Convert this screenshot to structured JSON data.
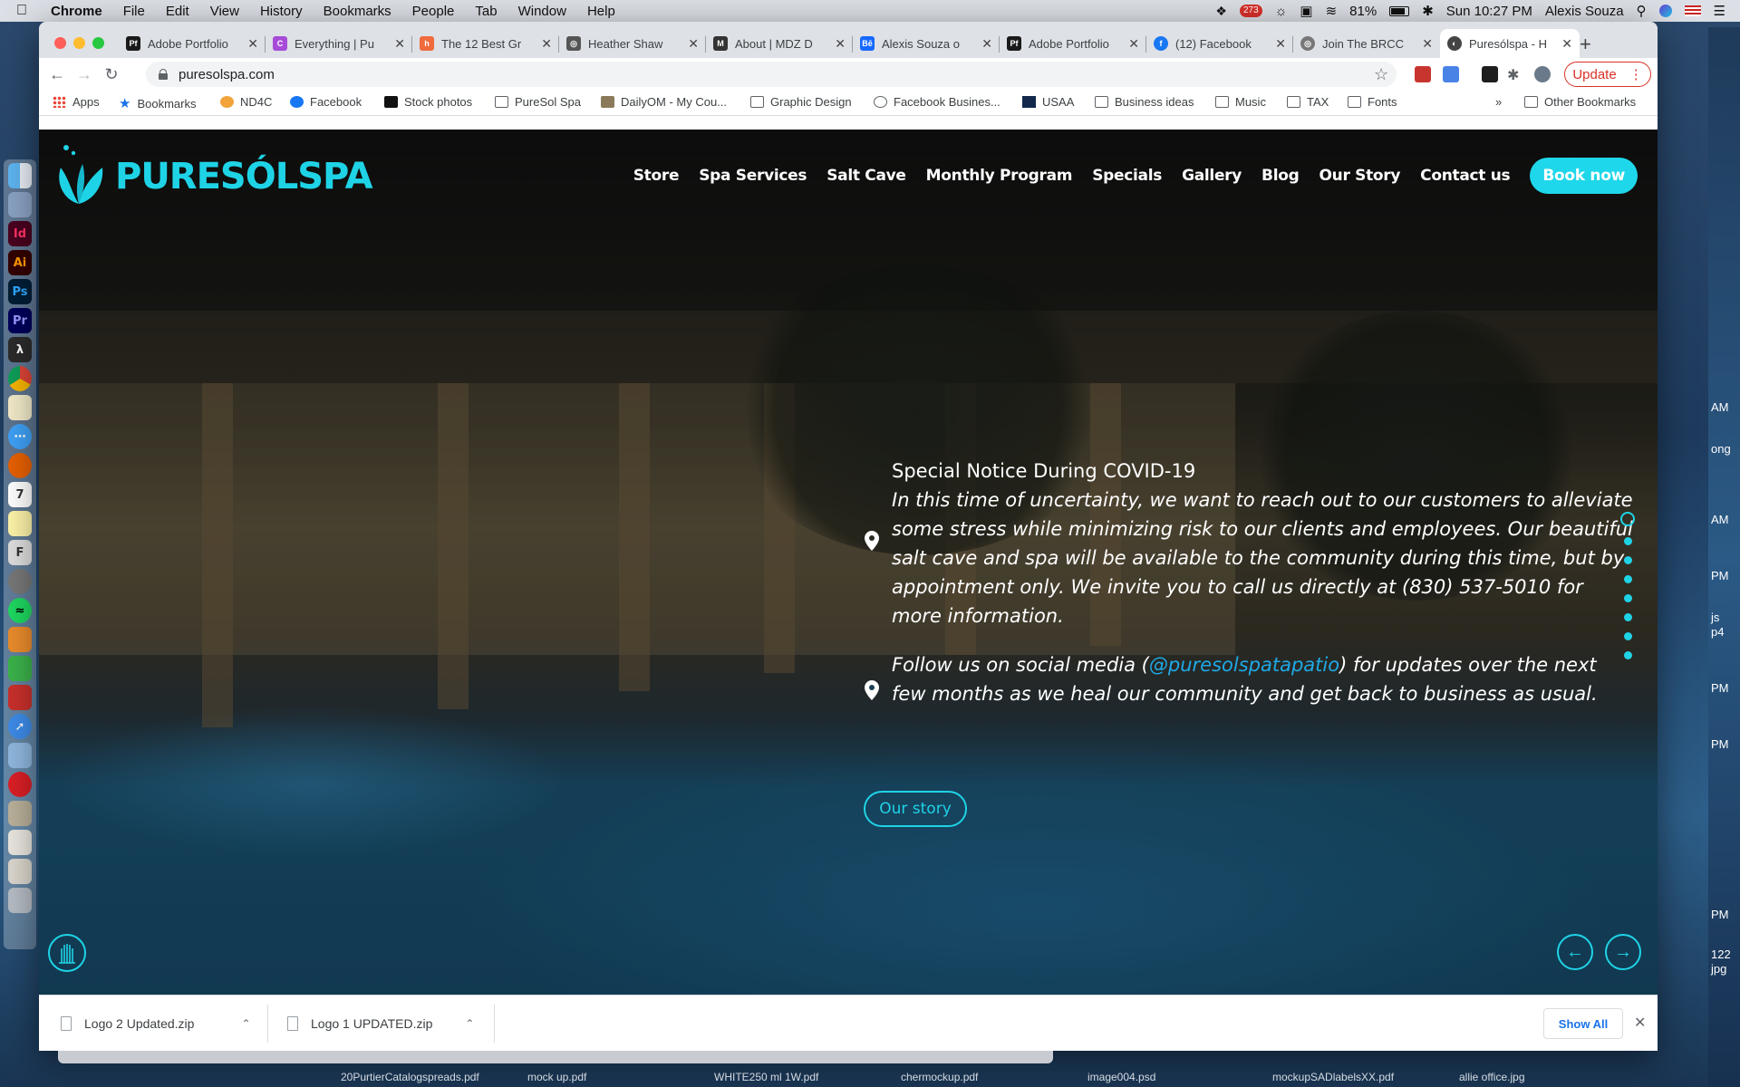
{
  "menubar": {
    "app": "Chrome",
    "items": [
      "File",
      "Edit",
      "View",
      "History",
      "Bookmarks",
      "People",
      "Tab",
      "Window",
      "Help"
    ],
    "mail_badge": "273",
    "battery": "81%",
    "datetime": "Sun 10:27 PM",
    "user": "Alexis Souza"
  },
  "tabs": [
    {
      "label": "Adobe Portfolio",
      "fav_color": "#1a1a1a",
      "fav_text": "Pf"
    },
    {
      "label": "Everything | Pu",
      "fav_color": "#a64bd8",
      "fav_text": "C"
    },
    {
      "label": "The 12 Best Gr",
      "fav_color": "#f06a3c",
      "fav_text": "h"
    },
    {
      "label": "Heather Shaw",
      "fav_color": "#555555",
      "fav_text": "◎"
    },
    {
      "label": "About | MDZ D",
      "fav_color": "#333333",
      "fav_text": "M"
    },
    {
      "label": "Alexis Souza o",
      "fav_color": "#1769ff",
      "fav_text": "Bē"
    },
    {
      "label": "Adobe Portfolio",
      "fav_color": "#1a1a1a",
      "fav_text": "Pf"
    },
    {
      "label": "(12) Facebook",
      "fav_color": "#1877f2",
      "fav_text": "f"
    },
    {
      "label": "Join The BRCC",
      "fav_color": "#777777",
      "fav_text": "◎"
    },
    {
      "label": "Puresólspa - H",
      "fav_color": "#444444",
      "fav_text": "◐"
    }
  ],
  "toolbar": {
    "url": "puresolspa.com",
    "update_label": "Update"
  },
  "bookmarks": [
    {
      "label": "Apps",
      "icon": "apps-grid-icon"
    },
    {
      "label": "Bookmarks",
      "icon": "star-icon"
    },
    {
      "label": "ND4C",
      "icon": "nd4c-icon"
    },
    {
      "label": "Facebook",
      "icon": "facebook-icon"
    },
    {
      "label": "Stock photos",
      "icon": "stock-icon"
    },
    {
      "label": "PureSol Spa",
      "icon": "folder-icon"
    },
    {
      "label": "DailyOM - My Cou...",
      "icon": "dailyom-icon"
    },
    {
      "label": "Graphic Design",
      "icon": "folder-icon"
    },
    {
      "label": "Facebook Busines...",
      "icon": "facebook-business-icon"
    },
    {
      "label": "USAA",
      "icon": "usaa-icon"
    },
    {
      "label": "Business ideas",
      "icon": "folder-icon"
    },
    {
      "label": "Music",
      "icon": "folder-icon"
    },
    {
      "label": "TAX",
      "icon": "folder-icon"
    },
    {
      "label": "Fonts",
      "icon": "folder-icon"
    }
  ],
  "bookmarks_overflow": "»",
  "other_bookmarks": "Other Bookmarks",
  "site": {
    "logo_text": "PURESÓLSPA",
    "nav": [
      "Store",
      "Spa Services",
      "Salt Cave",
      "Monthly Program",
      "Specials",
      "Gallery",
      "Blog",
      "Our Story",
      "Contact us"
    ],
    "book_now": "Book now",
    "notice_title": "Special Notice During COVID-19",
    "notice_body": "In this time of uncertainty, we want to reach out to our customers to alleviate some stress while minimizing risk to our clients and employees. Our beautiful salt cave and spa will be available to the community during this time, but by appointment only. We invite you to call us directly at (830) 537-5010 for more information.",
    "follow_pre": "Follow us on social media (",
    "follow_handle": "@puresolspatapatio",
    "follow_post": ") for updates over the next few months as we heal our community and get back to business as usual.",
    "our_story": "Our story",
    "slides_total": 8,
    "slide_active": 1,
    "accent": "#1fd3e6"
  },
  "downloads": [
    {
      "name": "Logo 2 Updated.zip"
    },
    {
      "name": "Logo 1 UPDATED.zip"
    }
  ],
  "downloads_show_all": "Show All",
  "desktop_labels": [
    "AM",
    "ong",
    "AM",
    "PM",
    "js",
    "p4",
    "PM",
    "PM",
    "PM",
    "122",
    "jpg"
  ],
  "desktop_files": [
    "20PurtierCatalogspreads.pdf",
    "mock up.pdf",
    "WHITE250 ml 1W.pdf",
    "chermockup.pdf",
    "image004.psd",
    "mockupSADlabelsXX.pdf",
    "allie office.jpg"
  ]
}
